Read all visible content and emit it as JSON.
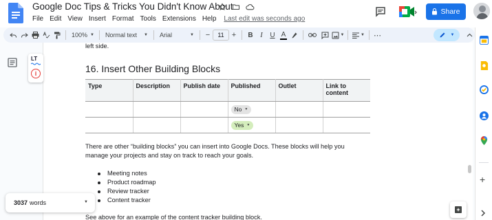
{
  "document": {
    "title": "Google Doc Tips & Tricks You Didn't Know About",
    "last_edit": "Last edit was seconds ago"
  },
  "menu": [
    "File",
    "Edit",
    "View",
    "Insert",
    "Format",
    "Tools",
    "Extensions",
    "Help"
  ],
  "header": {
    "share_label": "Share"
  },
  "toolbar": {
    "zoom": "100%",
    "style": "Normal text",
    "font": "Arial",
    "font_size": "11",
    "bold": "B",
    "italic": "I",
    "underline": "U",
    "text_color_glyph": "A"
  },
  "body": {
    "prev_line": "left side.",
    "heading": "16. Insert Other Building Blocks",
    "table": {
      "headers": [
        "Type",
        "Description",
        "Publish date",
        "Published",
        "Outlet",
        "Link to content"
      ],
      "rows": [
        {
          "published": "No"
        },
        {
          "published": "Yes"
        }
      ]
    },
    "paragraph_line1": "There are other “building blocks” you can insert into Google Docs. These blocks will help you",
    "paragraph_line2": "manage your projects and stay on track to reach your goals.",
    "bullets": [
      "Meeting notes",
      "Product roadmap",
      "Review tracker",
      "Content tracker"
    ],
    "footer_line": "See above for an example of the content tracker building block."
  },
  "word_count": {
    "count": "3037",
    "label": "words"
  },
  "languagetool": {
    "logo": "LT",
    "alert_glyph": "i"
  },
  "colors": {
    "share_blue": "#1a73e8",
    "toolbar_bg": "#edf2fa",
    "chip_no": "#e3e3e3",
    "chip_yes": "#d4edbc"
  }
}
